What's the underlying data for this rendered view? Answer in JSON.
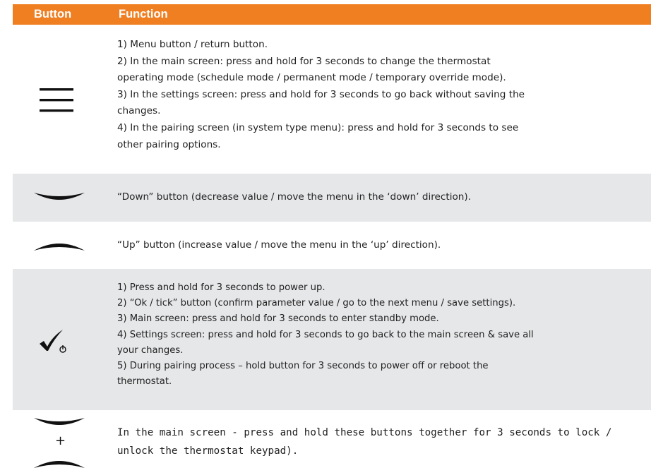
{
  "table": {
    "headers": {
      "button": "Button",
      "function": "Function"
    },
    "rows": [
      {
        "icon": "menu-icon",
        "lines": [
          "1) Menu button / return button.",
          "2) In the main screen: press and hold for 3 seconds to change the thermostat",
          "operating mode (schedule mode / permanent mode / temporary override mode).",
          "3) In the settings screen: press and hold for 3 seconds to go back without saving the",
          "changes.",
          "4) In the pairing screen (in system type menu): press and hold for 3 seconds to see",
          "other pairing options."
        ]
      },
      {
        "icon": "chevron-down-icon",
        "lines": [
          "“Down” button (decrease value / move the menu in the ‘down’ direction)."
        ]
      },
      {
        "icon": "chevron-up-icon",
        "lines": [
          "“Up” button (increase value / move the menu in the ‘up’ direction)."
        ]
      },
      {
        "icon": "tick-power-icon",
        "lines": [
          " 1) Press and hold for 3 seconds to power up.",
          " 2) “Ok / tick” button (confirm parameter value / go to the next menu / save settings).",
          " 3) Main screen: press and hold for 3 seconds to enter standby mode.",
          " 4) Settings screen: press and hold for 3 seconds to go back to the main screen & save all",
          "your changes.",
          " 5) During pairing process – hold button for 3 seconds to power off or reboot the",
          "thermostat."
        ]
      },
      {
        "icon": "down-plus-up-icon",
        "plus": "+",
        "lines": [
          "In the main screen - press and hold these buttons together for 3 seconds to lock /",
          "unlock the thermostat keypad)."
        ]
      }
    ]
  },
  "colors": {
    "header": "#f07f22",
    "stripe": "#e6e7e9",
    "text": "#222222"
  }
}
